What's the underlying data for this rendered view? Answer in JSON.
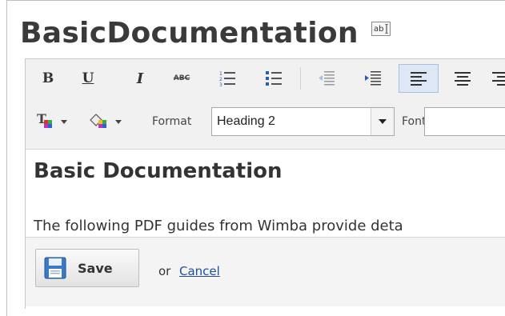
{
  "page": {
    "title": "BasicDocumentation",
    "rename_icon_text": "ab"
  },
  "toolbar": {
    "bold_label": "B",
    "underline_label": "U",
    "italic_label": "I",
    "strike_label": "ABC",
    "format_label": "Format",
    "format_value": "Heading 2",
    "font_label": "Font",
    "font_value": "",
    "icons": [
      "bold-icon",
      "underline-icon",
      "italic-icon",
      "strikethrough-icon",
      "numbered-list-icon",
      "bulleted-list-icon",
      "outdent-icon",
      "indent-icon",
      "align-left-icon",
      "align-center-icon",
      "align-right-icon",
      "text-color-icon",
      "background-color-icon"
    ],
    "active_button": "align-left",
    "accent_color": "#dde7f5"
  },
  "content": {
    "heading": "Basic Documentation",
    "paragraph": "The following PDF guides from Wimba provide deta"
  },
  "footer": {
    "save_label": "Save",
    "or_text": "or",
    "cancel_label": "Cancel"
  },
  "colors": {
    "link": "#1d4f9c",
    "title": "#3a3a3a",
    "toolbar_bg": "#f1f1f1"
  }
}
